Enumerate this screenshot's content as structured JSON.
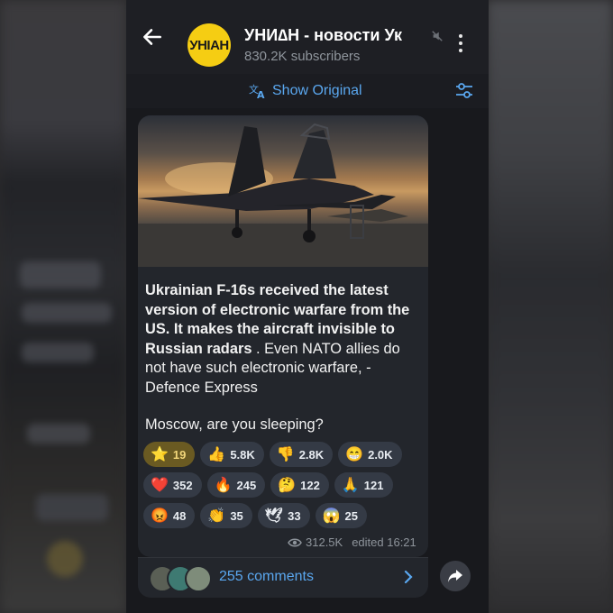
{
  "channel": {
    "title": "УНИ∆Н - новости Ук",
    "subscribers": "830.2K subscribers",
    "logo_text": "УНІАН",
    "logo_color": "#f5cd13"
  },
  "translate": {
    "label": "Show Original"
  },
  "post": {
    "text_bold": "Ukrainian F-16s received the latest version of electronic warfare from the US. It makes the aircraft invisible to Russian radars",
    "text_rest": " . Even NATO allies do not have such electronic warfare, - Defence Express",
    "question": "Moscow, are you sleeping?",
    "views": "312.5K",
    "edited": "edited 16:21"
  },
  "reactions": [
    [
      {
        "emoji": "⭐",
        "count": "19"
      },
      {
        "emoji": "👍",
        "count": "5.8K"
      },
      {
        "emoji": "👎",
        "count": "2.8K"
      },
      {
        "emoji": "😁",
        "count": "2.0K"
      }
    ],
    [
      {
        "emoji": "❤️",
        "count": "352"
      },
      {
        "emoji": "🔥",
        "count": "245"
      },
      {
        "emoji": "🤔",
        "count": "122"
      },
      {
        "emoji": "🙏",
        "count": "121"
      }
    ],
    [
      {
        "emoji": "😡",
        "count": "48"
      },
      {
        "emoji": "👏",
        "count": "35"
      },
      {
        "emoji": "🕊",
        "count": "33"
      },
      {
        "emoji": "😱",
        "count": "25"
      }
    ]
  ],
  "comments": {
    "label": "255 comments"
  },
  "colors": {
    "accent": "#5aa7ef",
    "bubble": "#23262c",
    "screen": "#18191d"
  }
}
